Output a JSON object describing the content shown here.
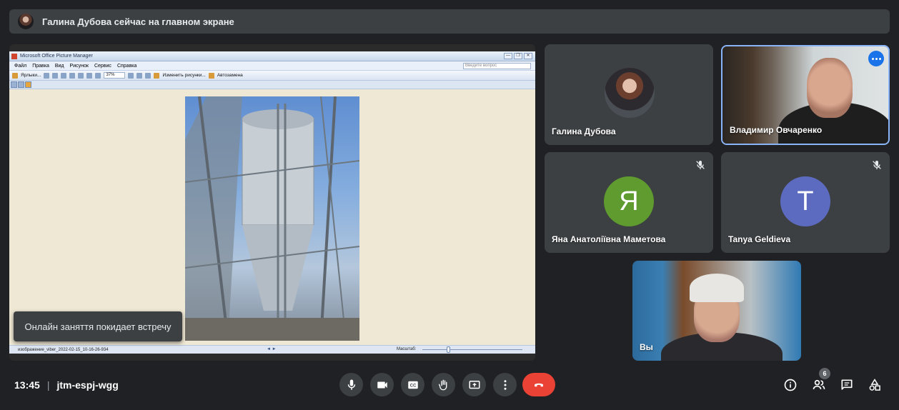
{
  "banner": {
    "text": "Галина Дубова сейчас на главном экране"
  },
  "presentation": {
    "window_title": "Microsoft Office Picture Manager",
    "window_buttons": [
      "—",
      "❐",
      "✕"
    ],
    "menu": [
      "Файл",
      "Правка",
      "Вид",
      "Рисунок",
      "Сервис",
      "Справка"
    ],
    "ask_placeholder": "Введите вопрос",
    "toolbar": {
      "shortcuts": "Ярлыки...",
      "zoom": "37%",
      "edit": "Изменить рисунки...",
      "autofix": "Автозамена"
    },
    "status": {
      "filename": "изображение_viber_2022-02-15_10-16-26-934",
      "nav": "◄ ►",
      "zoom_label": "Масштаб:"
    }
  },
  "toast": "Онлайн заняття покидает встречу",
  "participants": [
    {
      "name": "Галина Дубова"
    },
    {
      "name": "Владимир Овчаренко"
    },
    {
      "name": "Яна Анатоліївна Маметова",
      "initial": "Я",
      "color": "#5f9b2e"
    },
    {
      "name": "Tanya Geldieva",
      "initial": "T",
      "color": "#5c6bc0"
    },
    {
      "name": "Вы"
    }
  ],
  "footer": {
    "time": "13:45",
    "separator": "|",
    "meeting_code": "jtm-espj-wgg",
    "people_count": "6"
  },
  "colors": {
    "end_call": "#ea4335",
    "accent": "#8ab4f8",
    "background": "#202124"
  }
}
